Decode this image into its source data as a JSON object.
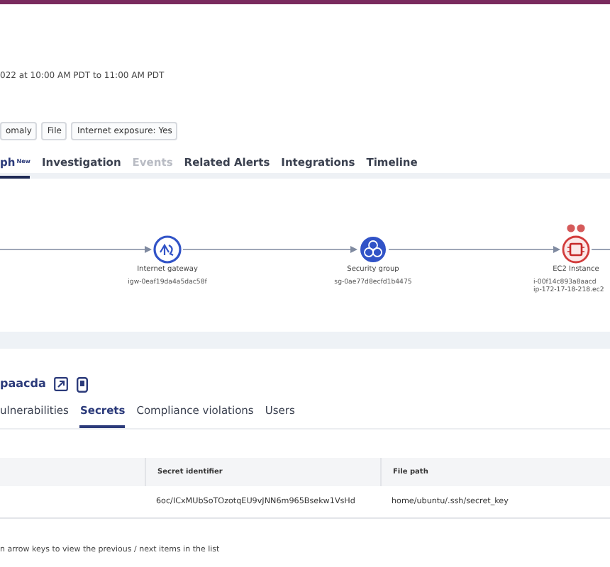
{
  "header": {
    "time_range": "022 at 10:00 AM PDT to 11:00 AM PDT",
    "tags": [
      "omaly",
      "File",
      "Internet exposure: Yes"
    ]
  },
  "tabs": [
    {
      "label": "ph",
      "badge": "New",
      "selected": true,
      "disabled": false
    },
    {
      "label": "Investigation",
      "selected": false,
      "disabled": false
    },
    {
      "label": "Events",
      "selected": false,
      "disabled": true
    },
    {
      "label": "Related Alerts",
      "selected": false,
      "disabled": false
    },
    {
      "label": "Integrations",
      "selected": false,
      "disabled": false
    },
    {
      "label": "Timeline",
      "selected": false,
      "disabled": false
    }
  ],
  "graph": {
    "nodes": [
      {
        "kind": "gateway",
        "title": "Internet gateway",
        "lines": [
          "igw-0eaf19da4a5dac58f"
        ]
      },
      {
        "kind": "security_group",
        "title": "Security group",
        "lines": [
          "sg-0ae77d8ecfd1b4475"
        ]
      },
      {
        "kind": "instance",
        "title": "EC2 Instance",
        "alert_dots": [
          {
            "color": "#d55a5a"
          },
          {
            "color": "#d55a5a"
          }
        ],
        "lines": [
          "i-00f14c893a8aacd",
          "ip-172-17-18-218.ec2"
        ]
      }
    ]
  },
  "resource": {
    "name": "paacda",
    "tabs": [
      {
        "label": "ulnerabilities",
        "selected": false
      },
      {
        "label": "Secrets",
        "selected": true
      },
      {
        "label": "Compliance violations",
        "selected": false
      },
      {
        "label": "Users",
        "selected": false
      }
    ]
  },
  "table": {
    "columns": [
      "Secret identifier",
      "File path"
    ],
    "rows": [
      [
        "6oc/ICxMUbSoTOzotqEU9vJNN6m965Bsekw1VsHd",
        "home/ubuntu/.ssh/secret_key"
      ]
    ]
  },
  "hint": "n arrow keys to view the previous / next items in the list"
}
